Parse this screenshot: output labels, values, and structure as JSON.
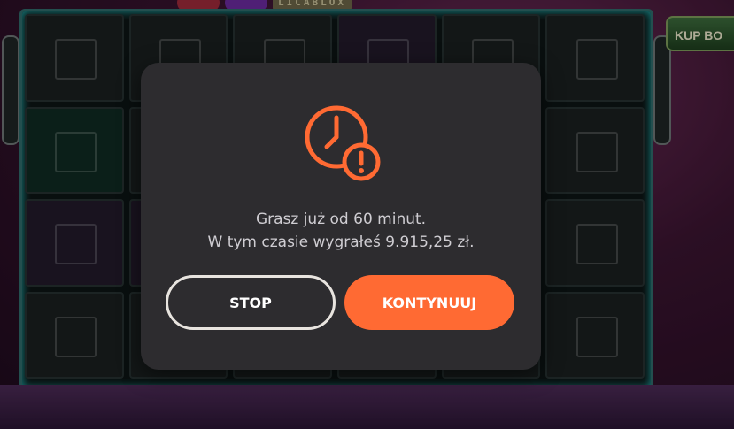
{
  "game": {
    "logo_text": "LICABLOX",
    "buy_button_label": "KUP BO"
  },
  "modal": {
    "icon": "clock-alert-icon",
    "message_line1": "Grasz już od 60 minut.",
    "message_line2": "W tym czasie wygrałeś 9.915,25 zł.",
    "stop_label": "STOP",
    "continue_label": "KONTYNUUJ"
  },
  "colors": {
    "accent": "#ff6a33",
    "modal_bg": "#2d2c2f",
    "text": "#cfcdd2",
    "outline_button": "#e8e4df"
  }
}
